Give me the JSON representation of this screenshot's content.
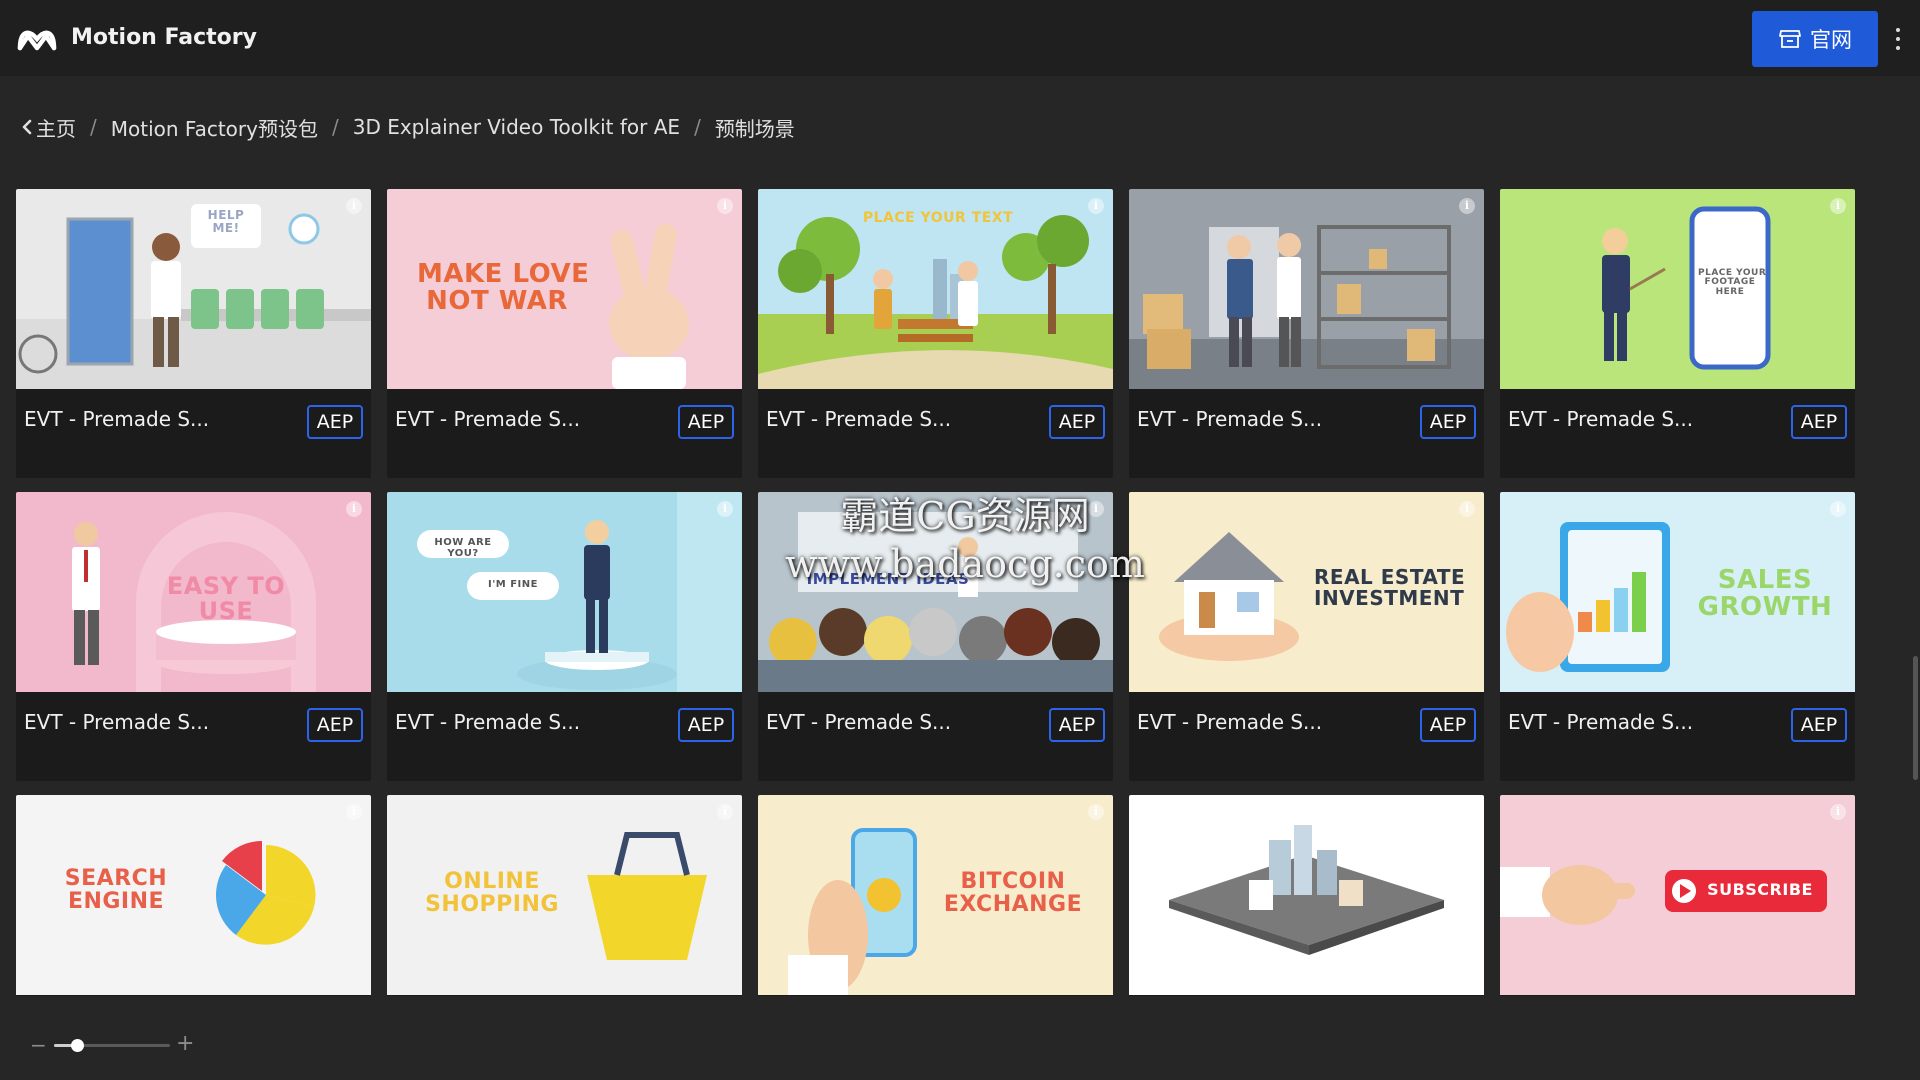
{
  "header": {
    "brand": "Motion Factory",
    "site_button_label": "官网",
    "logo_icon": "motion-factory-logo-icon",
    "site_button_icon": "storefront-icon",
    "more_icon": "more-vertical-icon"
  },
  "breadcrumb": {
    "items": [
      "主页",
      "Motion Factory预设包",
      "3D Explainer Video Toolkit for AE",
      "预制场景"
    ],
    "separator": "/"
  },
  "grid": {
    "cards": [
      {
        "title": "EVT - Premade S...",
        "badge": "AEP",
        "thumb_text": "HELP\nME!",
        "info": "i"
      },
      {
        "title": "EVT - Premade S...",
        "badge": "AEP",
        "thumb_text": "MAKE LOVE\nNOT WAR",
        "info": "i"
      },
      {
        "title": "EVT - Premade S...",
        "badge": "AEP",
        "thumb_text": "PLACE YOUR TEXT",
        "info": "i"
      },
      {
        "title": "EVT - Premade S...",
        "badge": "AEP",
        "thumb_text": "",
        "info": "i"
      },
      {
        "title": "EVT - Premade S...",
        "badge": "AEP",
        "thumb_text": "PLACE YOUR\nFOOTAGE\nHERE",
        "info": "i"
      },
      {
        "title": "EVT - Premade S...",
        "badge": "AEP",
        "thumb_text": "EASY TO USE",
        "info": "i"
      },
      {
        "title": "EVT - Premade S...",
        "badge": "AEP",
        "thumb_text": "HOW ARE YOU?|I'M FINE",
        "info": "i"
      },
      {
        "title": "EVT - Premade S...",
        "badge": "AEP",
        "thumb_text": "IMPLEMENT IDEAS",
        "info": "i"
      },
      {
        "title": "EVT - Premade S...",
        "badge": "AEP",
        "thumb_text": "REAL ESTATE\nINVESTMENT",
        "info": "i"
      },
      {
        "title": "EVT - Premade S...",
        "badge": "AEP",
        "thumb_text": "SALES\nGROWTH",
        "info": "i"
      },
      {
        "title": "",
        "badge": "",
        "thumb_text": "SEARCH\nENGINE",
        "info": "i"
      },
      {
        "title": "",
        "badge": "",
        "thumb_text": "ONLINE\nSHOPPING",
        "info": "i"
      },
      {
        "title": "",
        "badge": "",
        "thumb_text": "BITCOIN\nEXCHANGE",
        "info": "i"
      },
      {
        "title": "",
        "badge": "",
        "thumb_text": "",
        "info": ""
      },
      {
        "title": "",
        "badge": "",
        "thumb_text": "SUBSCRIBE",
        "info": "i"
      }
    ]
  },
  "watermark": {
    "line1": "霸道CG资源网",
    "line2": "www.badaocg.com"
  },
  "zoom": {
    "minus_label": "−",
    "plus_label": "+",
    "level_fraction": 0.2
  },
  "colors": {
    "accent": "#1f5ad8",
    "badge_border": "#2b64e8",
    "background": "#262626",
    "card": "#1b1b1b"
  }
}
